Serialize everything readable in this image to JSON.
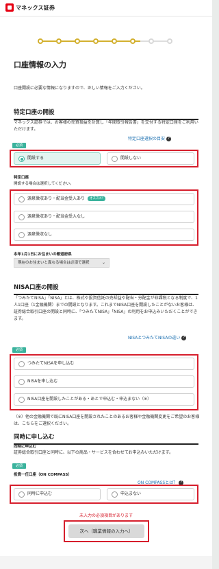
{
  "brand": {
    "name": "マネックス証券"
  },
  "progress": {
    "current_step": 4,
    "total_steps": 8
  },
  "title": "口座情報の入力",
  "intro": "口座開設に必要な情報になりますので、正しい情報をご入力ください。",
  "tokutei": {
    "heading": "特定口座の開設",
    "description": "マネックス証券では、お客様の売買損益を計算し「年間取引報告書」を交付する特定口座をご利用いただけます。",
    "help_link": "特定口座選択の目安",
    "required_badge": "必須",
    "options": [
      "開設する",
      "開設しない"
    ],
    "selected": 0,
    "sub_label": "特定口座",
    "sub_note": "開設する場合は選択してください。",
    "sub_options": [
      "源泉徴収あり・配当金受入あり",
      "源泉徴収あり・配当金受入なし",
      "源泉徴収なし"
    ],
    "recommend_badge": "オススメ!",
    "residence_label": "本年1月1日にお住まいの都道府県",
    "residence_value": "現在のお住まいと異なる場合は必須で選択"
  },
  "nisa": {
    "heading": "NISA口座の開設",
    "description": "「つみたてNISA」「NISA」とは、株式や投資信託の売却益や配当・分配金が非課税となる制度で、1人1口座（1金融機関）までの開設となります。これまでNISA口座を開設したことがないお客様は、証券総合取引口座の開設と同時に、「つみたてNISA」「NISA」の利用をお申込みいただくことができます。",
    "help_link": "NISAとつみたてNISAの違い",
    "required_badge": "必須",
    "options": [
      "つみたてNISAを申し込む",
      "NISAを申し込む",
      "NISA口座を開設したことがある・あとで申込む・申込まない（※）"
    ],
    "footnote": "（※）他の金融機関で既にNISA口座を開設されたことのあるお客様や金融機関変更をご希望のお客様は、こちらをご選択ください。"
  },
  "simultaneous": {
    "heading": "同時に申し込む",
    "sub_heading": "同時に申込む",
    "description": "証券総合取引口座と同時に、以下の商品・サービスを合わせてお申込みいただけます。",
    "oncompass_label": "投資一任口座（ON COMPASS）",
    "help_link": "ON COMPASSとは？",
    "required_badge": "必須",
    "options": [
      "同時に申込む",
      "申込まない"
    ]
  },
  "error_text": "未入力の必須項目があります",
  "next_button": "次へ（職業情報の入力へ）",
  "colors": {
    "accent": "#3bb39d",
    "progress": "#d3b02f",
    "error": "#d61e2c",
    "link": "#1a6fb0",
    "brand": "#e60012"
  }
}
